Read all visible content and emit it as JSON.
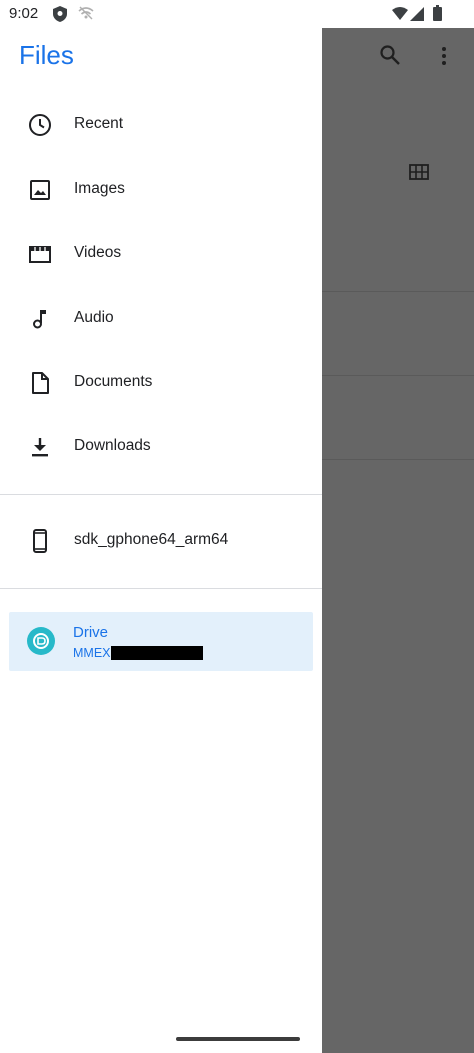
{
  "status_bar": {
    "time": "9:02",
    "icons": [
      "shield-icon",
      "wifi-off-icon",
      "wifi-icon",
      "signal-icon",
      "battery-icon"
    ]
  },
  "drawer": {
    "title": "Files",
    "items": [
      {
        "label": "Recent",
        "icon": "clock-icon"
      },
      {
        "label": "Images",
        "icon": "image-icon"
      },
      {
        "label": "Videos",
        "icon": "video-icon"
      },
      {
        "label": "Audio",
        "icon": "music-note-icon"
      },
      {
        "label": "Documents",
        "icon": "document-icon"
      },
      {
        "label": "Downloads",
        "icon": "download-icon"
      }
    ],
    "device": {
      "label": "sdk_gphone64_arm64",
      "icon": "phone-icon"
    },
    "drive": {
      "label": "Drive",
      "account": "MMEX",
      "icon": "drive-icon",
      "selected": true
    }
  },
  "background_toolbar": {
    "icons": [
      "search-icon",
      "more-vert-icon",
      "grid-view-icon"
    ]
  },
  "colors": {
    "accent": "#1a73e8",
    "selected_bg": "#e3f0fb",
    "scrim": "#666666",
    "drive_badge": "#27b9c9"
  }
}
